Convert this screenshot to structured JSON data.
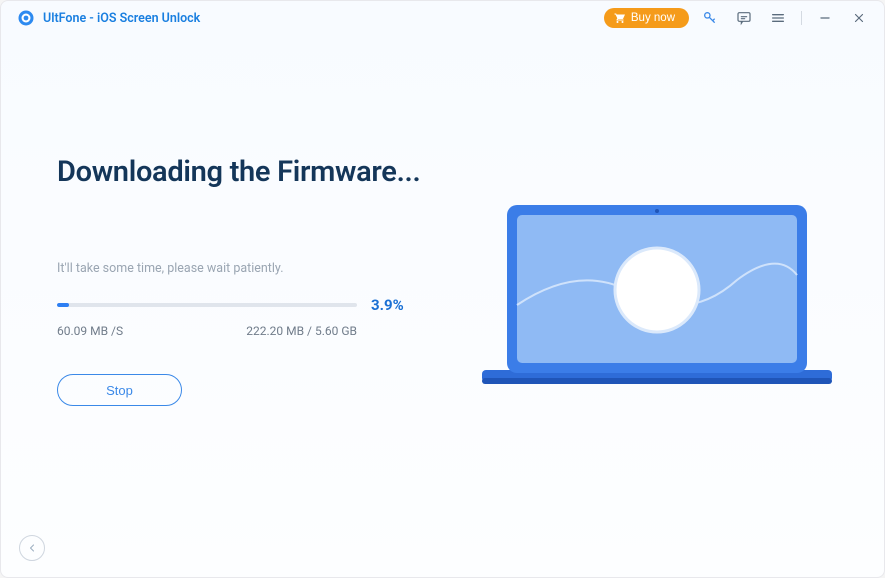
{
  "app": {
    "title": "UltFone - iOS Screen Unlock"
  },
  "titlebar": {
    "buy_now_label": "Buy now"
  },
  "main": {
    "heading": "Downloading the Firmware...",
    "wait_text": "It'll take some time, please wait patiently.",
    "progress_percent_label": "3.9%",
    "progress_percent_value": 3.9,
    "download_speed": "60.09 MB /S",
    "download_size": "222.20 MB / 5.60 GB",
    "stop_label": "Stop"
  },
  "colors": {
    "accent": "#2d7ff3",
    "buy_now": "#f59b1a",
    "title_text": "#143659"
  }
}
